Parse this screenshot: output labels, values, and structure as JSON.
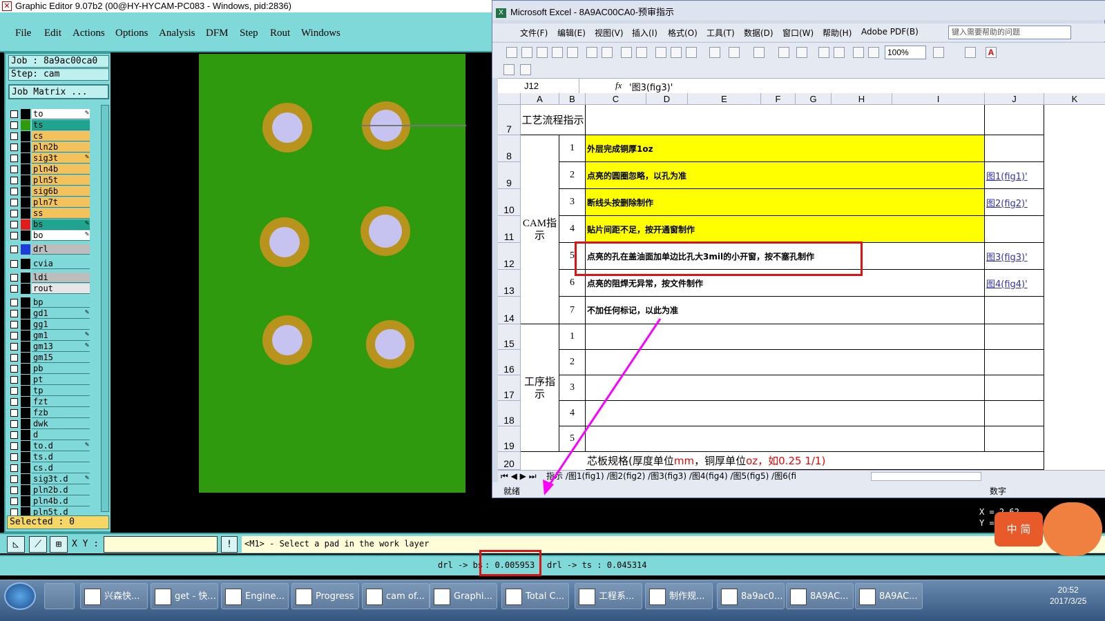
{
  "ge": {
    "title": "Graphic Editor 9.07b2 (00@HY-HYCAM-PC083 - Windows, pid:2836)",
    "menu": [
      "File",
      "Edit",
      "Actions",
      "Options",
      "Analysis",
      "DFM",
      "Step",
      "Rout",
      "Windows"
    ],
    "job": "Job : 8a9ac00ca0",
    "step": "Step: cam",
    "job_matrix": "Job Matrix ...",
    "layers": [
      {
        "name": "to",
        "color": "#ffffff",
        "swatch": "#000000",
        "edit": true
      },
      {
        "name": "ts",
        "color": "#1fa58f",
        "swatch": "#2f9a0e",
        "edit": false
      },
      {
        "name": "cs",
        "color": "#f3c25a",
        "swatch": "#000000",
        "edit": false
      },
      {
        "name": "pln2b",
        "color": "#f3c25a",
        "swatch": "#000000",
        "edit": false
      },
      {
        "name": "sig3t",
        "color": "#f3c25a",
        "swatch": "#000000",
        "edit": true
      },
      {
        "name": "pln4b",
        "color": "#f3c25a",
        "swatch": "#000000",
        "edit": false
      },
      {
        "name": "pln5t",
        "color": "#f3c25a",
        "swatch": "#000000",
        "edit": false
      },
      {
        "name": "sig6b",
        "color": "#f3c25a",
        "swatch": "#000000",
        "edit": false
      },
      {
        "name": "pln7t",
        "color": "#f3c25a",
        "swatch": "#000000",
        "edit": false
      },
      {
        "name": "ss",
        "color": "#f3c25a",
        "swatch": "#000000",
        "edit": false
      },
      {
        "name": "bs",
        "color": "#1fa58f",
        "swatch": "#e21b1b",
        "edit": true
      },
      {
        "name": "bo",
        "color": "#ffffff",
        "swatch": "#000000",
        "edit": true
      },
      {
        "name": "drl",
        "color": "#bdbdbd",
        "swatch": "#1f3bd8",
        "edit": false
      },
      {
        "name": "cvia",
        "color": "#7fd9d9",
        "swatch": "#000000",
        "edit": false
      },
      {
        "name": "ldi",
        "color": "#bdbdbd",
        "swatch": "#000000",
        "edit": false
      },
      {
        "name": "rout",
        "color": "#e6e6e6",
        "swatch": "#000000",
        "edit": false
      },
      {
        "name": "bp",
        "color": "#7fd9d9",
        "swatch": "#000000",
        "edit": false
      },
      {
        "name": "gd1",
        "color": "#7fd9d9",
        "swatch": "#000000",
        "edit": true
      },
      {
        "name": "gg1",
        "color": "#7fd9d9",
        "swatch": "#000000",
        "edit": false
      },
      {
        "name": "gm1",
        "color": "#7fd9d9",
        "swatch": "#000000",
        "edit": true
      },
      {
        "name": "gm13",
        "color": "#7fd9d9",
        "swatch": "#000000",
        "edit": true
      },
      {
        "name": "gm15",
        "color": "#7fd9d9",
        "swatch": "#000000",
        "edit": false
      },
      {
        "name": "pb",
        "color": "#7fd9d9",
        "swatch": "#000000",
        "edit": false
      },
      {
        "name": "pt",
        "color": "#7fd9d9",
        "swatch": "#000000",
        "edit": false
      },
      {
        "name": "tp",
        "color": "#7fd9d9",
        "swatch": "#000000",
        "edit": false
      },
      {
        "name": "fzt",
        "color": "#7fd9d9",
        "swatch": "#000000",
        "edit": false
      },
      {
        "name": "fzb",
        "color": "#7fd9d9",
        "swatch": "#000000",
        "edit": false
      },
      {
        "name": "dwk",
        "color": "#7fd9d9",
        "swatch": "#000000",
        "edit": false
      },
      {
        "name": "d",
        "color": "#7fd9d9",
        "swatch": "#000000",
        "edit": false
      },
      {
        "name": "to.d",
        "color": "#7fd9d9",
        "swatch": "#000000",
        "edit": true
      },
      {
        "name": "ts.d",
        "color": "#7fd9d9",
        "swatch": "#000000",
        "edit": false
      },
      {
        "name": "cs.d",
        "color": "#7fd9d9",
        "swatch": "#000000",
        "edit": false
      },
      {
        "name": "sig3t.d",
        "color": "#7fd9d9",
        "swatch": "#000000",
        "edit": true
      },
      {
        "name": "pln2b.d",
        "color": "#7fd9d9",
        "swatch": "#000000",
        "edit": false
      },
      {
        "name": "pln4b.d",
        "color": "#7fd9d9",
        "swatch": "#000000",
        "edit": false
      },
      {
        "name": "pln5t.d",
        "color": "#7fd9d9",
        "swatch": "#000000",
        "edit": false
      }
    ],
    "selected": "Selected : 0",
    "xy_label": "X Y :",
    "xy_value": "",
    "message": "<M1> - Select a pad in the work layer",
    "status_left": "drl -> bs",
    "status_mid": ": 0.005953",
    "status_right": "drl -> ts : 0.045314",
    "colors": {
      "board": "#2f9a0e",
      "pad": "#b8941c",
      "hole": "#c6c3f0",
      "panel": "#7fd9d9"
    }
  },
  "xl": {
    "title": "Microsoft Excel - 8A9AC00CA0-预审指示",
    "menu": [
      "文件(F)",
      "编辑(E)",
      "视图(V)",
      "插入(I)",
      "格式(O)",
      "工具(T)",
      "数据(D)",
      "窗口(W)",
      "帮助(H)",
      "Adobe PDF(B)"
    ],
    "help_placeholder": "键入需要帮助的问题",
    "zoom": "100%",
    "namebox": "J12",
    "fx": "fx",
    "formula": "'图3(fig3)'",
    "columns": [
      "A",
      "B",
      "C",
      "D",
      "E",
      "F",
      "G",
      "H",
      "I",
      "J",
      "K"
    ],
    "rows": [
      "7",
      "8",
      "9",
      "10",
      "11",
      "12",
      "13",
      "14",
      "15",
      "16",
      "17",
      "18",
      "19",
      "20"
    ],
    "header_process": "工艺流程指示",
    "group_cam": "CAM指示",
    "group_proc": "工序指示",
    "cam_items": [
      {
        "no": "1",
        "text": "外层完成铜厚1oz",
        "link": ""
      },
      {
        "no": "2",
        "text": "点亮的圆圈忽略，以孔为准",
        "link": "图1(fig1)'"
      },
      {
        "no": "3",
        "text": "断线头按删除制作",
        "link": "图2(fig2)'"
      },
      {
        "no": "4",
        "text": "贴片间距不足，按开通窗制作",
        "link": ""
      },
      {
        "no": "5",
        "text": "点亮的孔在盖油面加单边比孔大3mil的小开窗，按不塞孔制作",
        "link": "图3(fig3)'"
      },
      {
        "no": "6",
        "text": "点亮的阻焊无异常，按文件制作",
        "link": "图4(fig4)'"
      },
      {
        "no": "7",
        "text": "不加任何标记，以此为准",
        "link": ""
      }
    ],
    "proc_items": [
      "1",
      "2",
      "3",
      "4",
      "5"
    ],
    "row20_text": "芯板规格(厚度单位",
    "row20_mm": "mm",
    "row20_mid": "，铜厚单位",
    "row20_oz": "oz",
    "row20_rest": "，如0.25 1/1)",
    "tabs": "指示 /图1(fig1) /图2(fig2) /图3(fig3) /图4(fig4) /图5(fig5) /图6(fi",
    "status_ready": "就绪",
    "status_num": "数字"
  },
  "taskbar": {
    "tasks": [
      "兴森快...",
      "get - 快...",
      "Engine...",
      "Progress",
      "cam of...",
      "Graphi...",
      "Total C...",
      "工程系...",
      "制作规...",
      "8a9ac0...",
      "8A9AC...",
      "8A9AC..."
    ],
    "time": "20:52",
    "date": "2017/3/25"
  },
  "ime": {
    "label": "中 简",
    "coord": "X = 2.62\nY ="
  }
}
